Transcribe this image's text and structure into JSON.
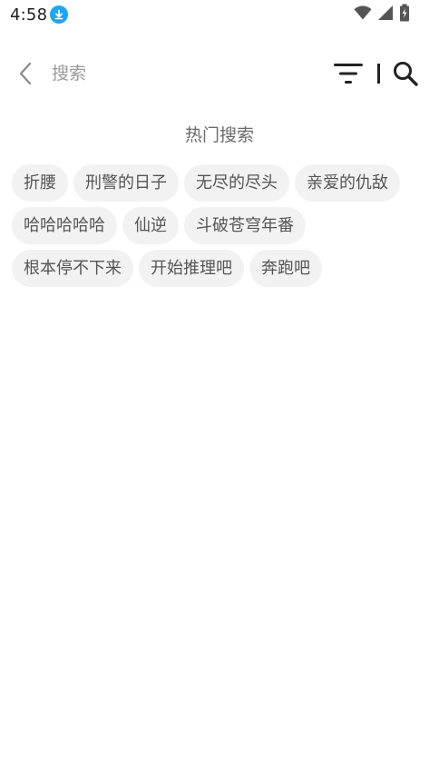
{
  "status_bar": {
    "time": "4:58",
    "icons": [
      "download-icon",
      "wifi-icon",
      "cellular-signal-icon",
      "battery-charging-icon"
    ]
  },
  "header": {
    "back_icon": "chevron-left-icon",
    "search_placeholder": "搜索",
    "filter_icon": "filter-icon",
    "search_icon": "search-icon"
  },
  "hot_search": {
    "title": "热门搜索",
    "tags": [
      "折腰",
      "刑警的日子",
      "无尽的尽头",
      "亲爱的仇敌",
      "哈哈哈哈哈",
      "仙逆",
      "斗破苍穹年番",
      "根本停不下来",
      "开始推理吧",
      "奔跑吧"
    ]
  },
  "colors": {
    "accent": "#1aa8f5",
    "tag_background": "#f2f2f2",
    "title_text": "#6a6a6a"
  }
}
